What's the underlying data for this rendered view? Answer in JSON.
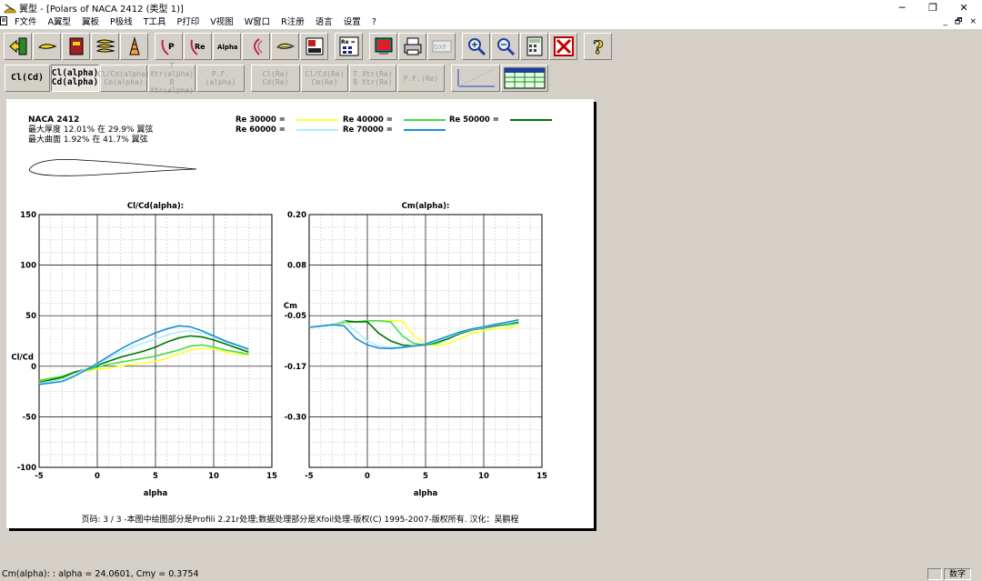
{
  "window": {
    "title": "翼型 - [Polars of NACA 2412 (类型 1)]"
  },
  "menu": [
    "F文件",
    "A翼型",
    "翼板",
    "P极线",
    "T工具",
    "P打印",
    "V视图",
    "W窗口",
    "R注册",
    "语言",
    "设置",
    "?"
  ],
  "toolbar2": {
    "cl_cd": "Cl(Cd)",
    "cl_alpha": "Cl(alpha)",
    "cd_alpha": "Cd(alpha)",
    "clcd_alpha": "Cl/Cd(alpha)",
    "cm_alpha": "Cm(alpha)",
    "txtr_alpha": "T Xtr(alpha)",
    "bxtr_alpha": "B Xtr(alpha)",
    "pf_alpha": "P.F.(alpha)",
    "cl_re": "Cl(Re)",
    "cd_re": "Cd(Re)",
    "clcd_re": "Cl/Cd(Re)",
    "cm_re": "Cm(Re)",
    "txtr_re": "T Xtr(Re)",
    "bxtr_re": "B Xtr(Re)",
    "pf_re": "P.F.(Re)"
  },
  "icons": {
    "re": "Re",
    "alpha": "Alpha",
    "p": "P",
    "dxf": "DXF",
    "re_grid": "Re ="
  },
  "airfoil": {
    "name": "NACA 2412",
    "thickness": "最大厚度 12.01% 在 29.9% 翼弦",
    "camber": "最大曲面 1.92% 在 41.7% 翼弦"
  },
  "legend": [
    {
      "label": "Re 30000 =",
      "color": "#ffff33"
    },
    {
      "label": "Re 40000 =",
      "color": "#44dd44"
    },
    {
      "label": "Re 50000 =",
      "color": "#007700"
    },
    {
      "label": "Re 60000 =",
      "color": "#aaf0ff"
    },
    {
      "label": "Re 70000 =",
      "color": "#1f8fd6"
    }
  ],
  "chart_data": [
    {
      "type": "line",
      "title": "Cl/Cd(alpha):",
      "xlabel": "alpha",
      "ylabel": "Cl/Cd",
      "xlim": [
        -5,
        15
      ],
      "ylim": [
        -100,
        150
      ],
      "xticks": [
        "-5",
        "0",
        "5",
        "10",
        "15"
      ],
      "yticks": [
        "150",
        "100",
        "50",
        "0",
        "-50",
        "-100"
      ],
      "grid": true,
      "series": [
        {
          "name": "Re 30000",
          "color": "#ffff33",
          "x": [
            -5,
            -3,
            -2,
            -1,
            0,
            1,
            2,
            3,
            4,
            5,
            6,
            7,
            8,
            9,
            10,
            11,
            12,
            13
          ],
          "y": [
            -15,
            -12,
            -8,
            -5,
            -3,
            -2,
            0,
            2,
            3,
            5,
            8,
            12,
            16,
            18,
            17,
            14,
            12,
            11
          ]
        },
        {
          "name": "Re 40000",
          "color": "#44dd44",
          "x": [
            -5,
            -3,
            -2,
            -1,
            0,
            1,
            2,
            3,
            4,
            5,
            6,
            7,
            8,
            9,
            10,
            11,
            12,
            13
          ],
          "y": [
            -14,
            -10,
            -6,
            -4,
            -1,
            2,
            4,
            6,
            8,
            10,
            13,
            16,
            20,
            21,
            19,
            16,
            14,
            12
          ]
        },
        {
          "name": "Re 50000",
          "color": "#007700",
          "x": [
            -5,
            -3,
            -2,
            -1,
            0,
            1,
            2,
            3,
            4,
            5,
            6,
            7,
            8,
            9,
            10,
            11,
            12,
            13
          ],
          "y": [
            -16,
            -11,
            -6,
            -3,
            1,
            5,
            9,
            12,
            15,
            19,
            24,
            28,
            30,
            29,
            26,
            22,
            18,
            14
          ]
        },
        {
          "name": "Re 60000",
          "color": "#aaf0ff",
          "x": [
            -5,
            -3,
            -2,
            -1,
            0,
            1,
            2,
            3,
            4,
            5,
            6,
            7,
            8,
            9,
            10,
            11,
            12,
            13
          ],
          "y": [
            -17,
            -13,
            -8,
            -3,
            2,
            8,
            14,
            19,
            23,
            27,
            31,
            34,
            35,
            33,
            29,
            24,
            20,
            16
          ]
        },
        {
          "name": "Re 70000",
          "color": "#1f8fd6",
          "x": [
            -5,
            -3,
            -2,
            -1,
            0,
            1,
            2,
            3,
            4,
            5,
            6,
            7,
            8,
            9,
            10,
            11,
            12,
            13
          ],
          "y": [
            -18,
            -15,
            -10,
            -4,
            3,
            10,
            17,
            23,
            28,
            33,
            37,
            40,
            39,
            35,
            30,
            25,
            21,
            17
          ]
        }
      ]
    },
    {
      "type": "line",
      "title": "Cm(alpha):",
      "xlabel": "alpha",
      "ylabel": "Cm",
      "xlim": [
        -5,
        15
      ],
      "ylim": [
        -0.3,
        0.2
      ],
      "xticks": [
        "-5",
        "0",
        "5",
        "10",
        "15"
      ],
      "yticks": [
        "0.20",
        "0.08",
        "-0.05",
        "-0.17",
        "-0.30"
      ],
      "grid": true,
      "series": [
        {
          "name": "Re 30000",
          "color": "#ffff33",
          "x": [
            -5,
            -3,
            -2,
            -1,
            0,
            1,
            2,
            3,
            4,
            5,
            6,
            7,
            8,
            9,
            10,
            11,
            12,
            13
          ],
          "y": [
            -0.023,
            -0.018,
            -0.015,
            -0.012,
            -0.01,
            -0.01,
            -0.01,
            -0.01,
            -0.04,
            -0.055,
            -0.06,
            -0.055,
            -0.045,
            -0.035,
            -0.03,
            -0.025,
            -0.025,
            -0.02
          ]
        },
        {
          "name": "Re 40000",
          "color": "#44dd44",
          "x": [
            -5,
            -3,
            -2,
            -1,
            0,
            1,
            2,
            3,
            4,
            5,
            6,
            7,
            8,
            9,
            10,
            11,
            12,
            13
          ],
          "y": [
            -0.023,
            -0.018,
            -0.013,
            -0.012,
            -0.01,
            -0.01,
            -0.012,
            -0.04,
            -0.055,
            -0.058,
            -0.055,
            -0.045,
            -0.035,
            -0.028,
            -0.025,
            -0.02,
            -0.018,
            -0.015
          ]
        },
        {
          "name": "Re 50000",
          "color": "#007700",
          "x": [
            -5,
            -3,
            -2,
            -1,
            0,
            1,
            2,
            3,
            4,
            5,
            6,
            7,
            8,
            9,
            10,
            11,
            12,
            13
          ],
          "y": [
            -0.023,
            -0.018,
            -0.01,
            -0.012,
            -0.012,
            -0.035,
            -0.05,
            -0.058,
            -0.06,
            -0.058,
            -0.052,
            -0.045,
            -0.035,
            -0.028,
            -0.024,
            -0.02,
            -0.016,
            -0.012
          ]
        },
        {
          "name": "Re 60000",
          "color": "#aaf0ff",
          "x": [
            -5,
            -3,
            -2,
            -1,
            0,
            1,
            2,
            3,
            4,
            5,
            6,
            7,
            8,
            9,
            10,
            11,
            12,
            13
          ],
          "y": [
            -0.023,
            -0.018,
            -0.01,
            -0.03,
            -0.05,
            -0.06,
            -0.063,
            -0.062,
            -0.06,
            -0.057,
            -0.05,
            -0.042,
            -0.033,
            -0.027,
            -0.023,
            -0.018,
            -0.015,
            -0.01
          ]
        },
        {
          "name": "Re 70000",
          "color": "#1f8fd6",
          "x": [
            -5,
            -3,
            -2,
            -1,
            0,
            1,
            2,
            3,
            4,
            5,
            6,
            7,
            8,
            9,
            10,
            11,
            12,
            13
          ],
          "y": [
            -0.023,
            -0.018,
            -0.02,
            -0.045,
            -0.058,
            -0.064,
            -0.065,
            -0.063,
            -0.06,
            -0.056,
            -0.048,
            -0.04,
            -0.032,
            -0.026,
            -0.022,
            -0.017,
            -0.013,
            -0.008
          ]
        }
      ]
    }
  ],
  "footer": "页码: 3 / 3 -本图中绘图部分是Profili 2.21r处理;数据处理部分是Xfoil处理-版权(C) 1995-2007-版权所有. 汉化：吴鹏程",
  "status": {
    "text": "Cm(alpha): : alpha = 24.0601, Cmy = 0.3754",
    "num": "数字"
  }
}
